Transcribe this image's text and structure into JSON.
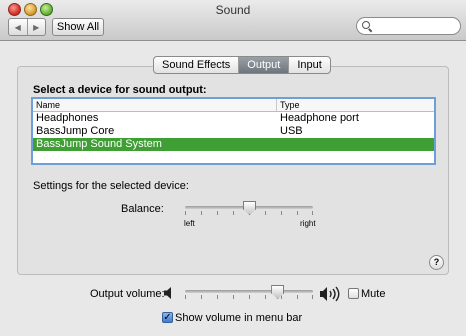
{
  "window": {
    "title": "Sound"
  },
  "toolbar": {
    "back": "◀",
    "forward": "▶",
    "show_all": "Show All",
    "search_placeholder": ""
  },
  "tabs": [
    {
      "label": "Sound Effects",
      "active": false
    },
    {
      "label": "Output",
      "active": true
    },
    {
      "label": "Input",
      "active": false
    }
  ],
  "output": {
    "select_label": "Select a device for sound output:",
    "columns": [
      "Name",
      "Type"
    ],
    "devices": [
      {
        "name": "Headphones",
        "type": "Headphone port",
        "selected": false
      },
      {
        "name": "BassJump Core",
        "type": "USB",
        "selected": false
      },
      {
        "name": "BassJump Sound System",
        "type": "",
        "selected": true
      }
    ],
    "settings_label": "Settings for the selected device:",
    "balance": {
      "label": "Balance:",
      "left": "left",
      "right": "right",
      "value": 0.5
    }
  },
  "help": "?",
  "volume": {
    "label": "Output volume:",
    "value": 0.72,
    "mute_label": "Mute",
    "mute_checked": false,
    "show_in_menu_label": "Show volume in menu bar",
    "show_in_menu_checked": true
  },
  "colors": {
    "selection": "#3f9e34",
    "focus_ring": "#6da0d8",
    "active_tab": "#7d838b"
  }
}
